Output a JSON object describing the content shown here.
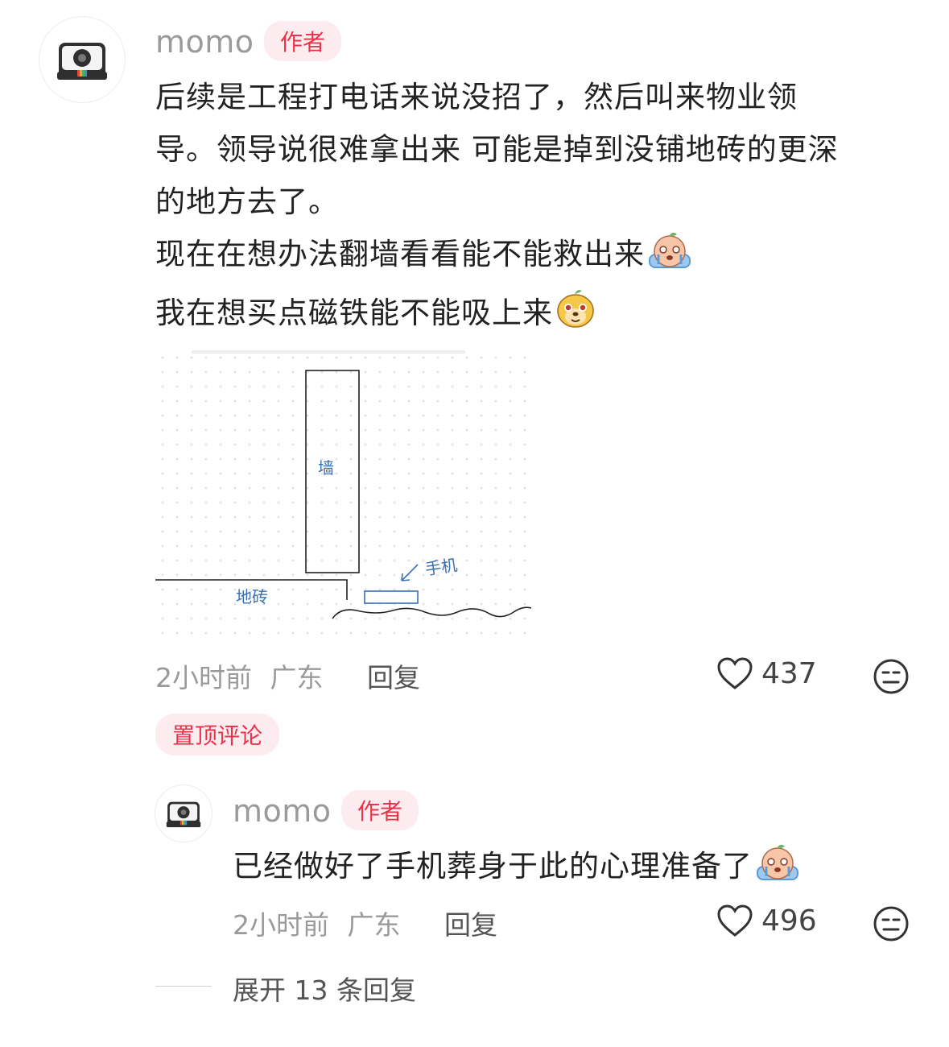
{
  "main_comment": {
    "author": "momo",
    "author_badge": "作者",
    "lines": [
      "后续是工程打电话来说没招了，然后叫来物业领",
      "导。领导说很难拿出来 可能是掉到没铺地砖的更深",
      "的地方去了。",
      "现在在想办法翻墙看看能不能救出来",
      "我在想买点磁铁能不能吸上来"
    ],
    "emojis": [
      "crying-emoji",
      "puppy-face-emoji"
    ],
    "drawing": {
      "wall_label": "墙",
      "phone_label": "手机",
      "tile_label": "地砖"
    },
    "time": "2小时前",
    "location": "广东",
    "reply_label": "回复",
    "likes": "437",
    "pinned_label": "置顶评论"
  },
  "reply_comment": {
    "author": "momo",
    "author_badge": "作者",
    "text": "已经做好了手机葬身于此的心理准备了",
    "time": "2小时前",
    "location": "广东",
    "reply_label": "回复",
    "likes": "496"
  },
  "expand_replies": {
    "prefix": "展开",
    "count": "13",
    "suffix": "条回复"
  },
  "colors": {
    "accent": "#e8334a",
    "badge_bg": "#fdecef",
    "muted_text": "#9a9a9a"
  }
}
